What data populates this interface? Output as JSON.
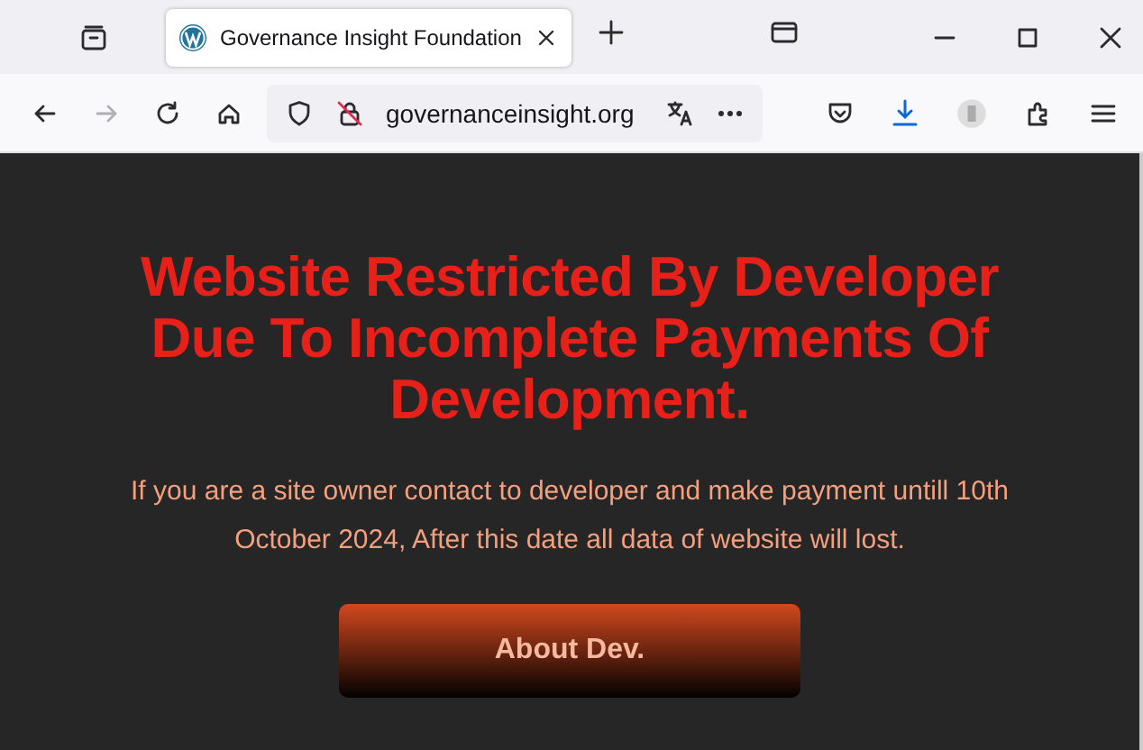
{
  "tabs": [
    {
      "label": "Governance Insight Foundation",
      "selected": true
    }
  ],
  "nav_buttons": [
    {
      "kind": "back",
      "disabled": false
    },
    {
      "kind": "forward",
      "disabled": true
    },
    {
      "kind": "reload",
      "disabled": false
    },
    {
      "kind": "home",
      "disabled": false
    }
  ],
  "address_bar": {
    "url": "governanceinsight.org"
  },
  "page": {
    "heading": "Website Restricted By Developer Due To Incomplete Payments Of Development.",
    "message": "If you are a site owner contact to developer and make payment untill 10th October 2024, After this date all data of website will lost.",
    "button": "About Dev."
  }
}
